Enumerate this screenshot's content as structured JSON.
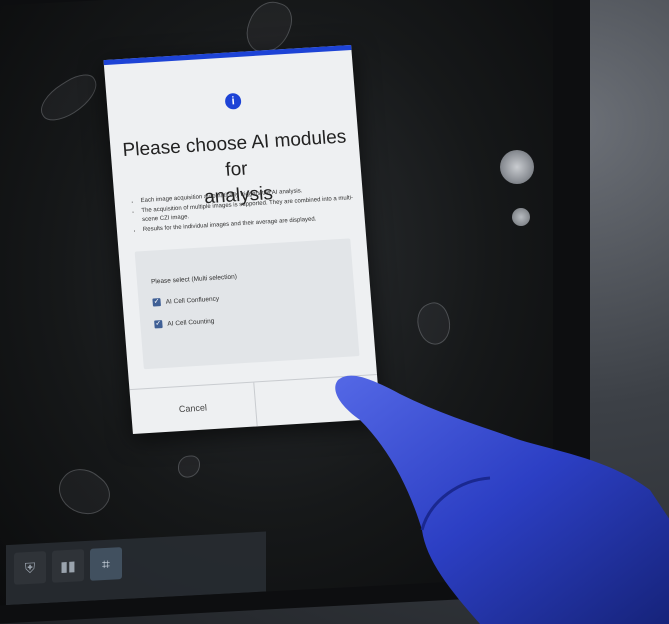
{
  "dialog": {
    "title_line1": "Please choose AI modules for",
    "title_line2": "analysis",
    "bullets": [
      "Each image acquisition automatically triggers the AI analysis.",
      "The acquisition of multiple images is supported. They are combined into a multi-scene CZI image.",
      "Results for the individual images and their average are displayed."
    ],
    "select_heading": "Please select (Multi selection)",
    "options": [
      {
        "label": "AI Cell Confluency",
        "checked": true
      },
      {
        "label": "AI Cell Counting",
        "checked": true
      }
    ],
    "cancel_label": "Cancel",
    "ok_label": "",
    "accent_color": "#1d43d6"
  },
  "taskbar": {
    "icons": [
      "shield-icon",
      "bar-chart-icon",
      "ai-analysis-icon"
    ]
  }
}
